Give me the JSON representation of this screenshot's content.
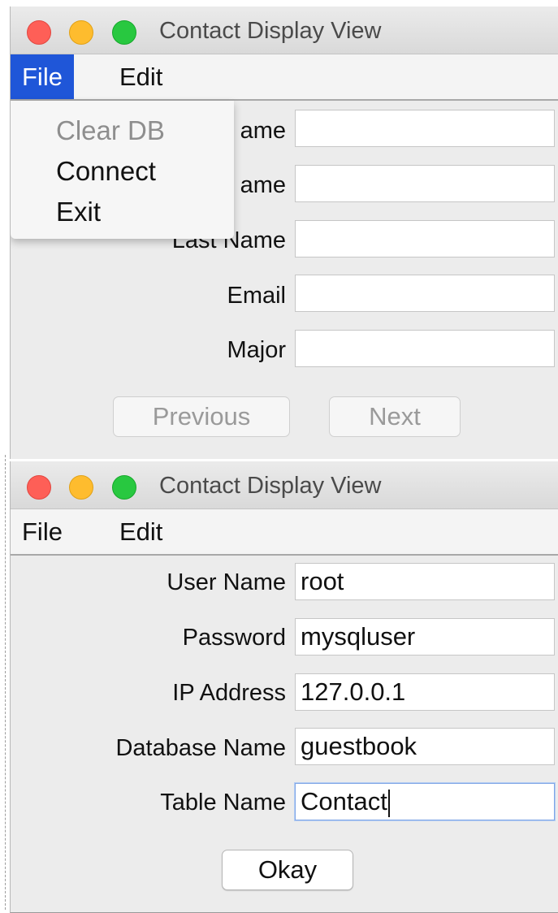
{
  "top_window": {
    "title": "Contact Display View",
    "menu": {
      "file": "File",
      "edit": "Edit"
    },
    "file_menu_items": [
      "Clear DB",
      "Connect",
      "Exit"
    ],
    "fields": [
      {
        "label": "First Name",
        "visible_label": "ame",
        "value": ""
      },
      {
        "label": "Middle Name",
        "visible_label": "ame",
        "value": ""
      },
      {
        "label": "Last Name",
        "visible_label": "Last Name",
        "value": ""
      },
      {
        "label": "Email",
        "visible_label": "Email",
        "value": ""
      },
      {
        "label": "Major",
        "visible_label": "Major",
        "value": ""
      }
    ],
    "buttons": {
      "previous": "Previous",
      "next": "Next"
    }
  },
  "bottom_window": {
    "title": "Contact Display View",
    "menu": {
      "file": "File",
      "edit": "Edit"
    },
    "fields": [
      {
        "label": "User Name",
        "value": "root"
      },
      {
        "label": "Password",
        "value": "mysqluser"
      },
      {
        "label": "IP Address",
        "value": "127.0.0.1"
      },
      {
        "label": "Database Name",
        "value": "guestbook"
      },
      {
        "label": "Table Name",
        "value": "Contact"
      }
    ],
    "buttons": {
      "okay": "Okay"
    }
  },
  "colors": {
    "menu_highlight": "#1f56d8",
    "close": "#fe5f57",
    "minimize": "#febc2e",
    "zoom": "#28c840"
  }
}
